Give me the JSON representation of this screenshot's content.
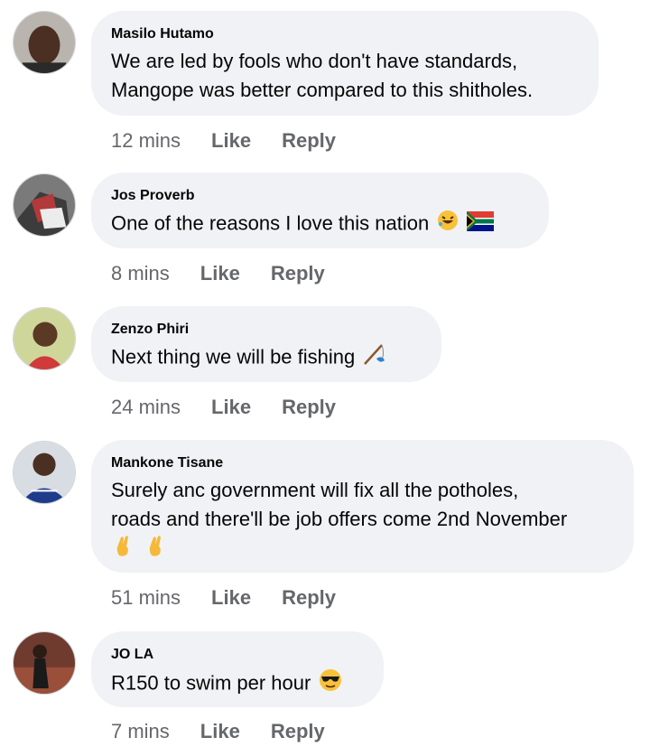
{
  "actions": {
    "like": "Like",
    "reply": "Reply"
  },
  "comments": [
    {
      "author": "Masilo Hutamo",
      "text": "We are led by fools who don't have standards,\nMangope was better compared to this shitholes.",
      "time": "12 mins"
    },
    {
      "author": "Jos Proverb",
      "text": "One of the reasons I love this nation",
      "time": "8 mins"
    },
    {
      "author": "Zenzo Phiri",
      "text": "Next thing we will be fishing",
      "time": "24 mins"
    },
    {
      "author": "Mankone Tisane",
      "text": "Surely anc government will fix all the potholes,\nroads and there'll be job offers come 2nd November",
      "time": "51 mins"
    },
    {
      "author": "JO LA",
      "text": "R150 to swim per hour",
      "time": "7 mins"
    }
  ]
}
